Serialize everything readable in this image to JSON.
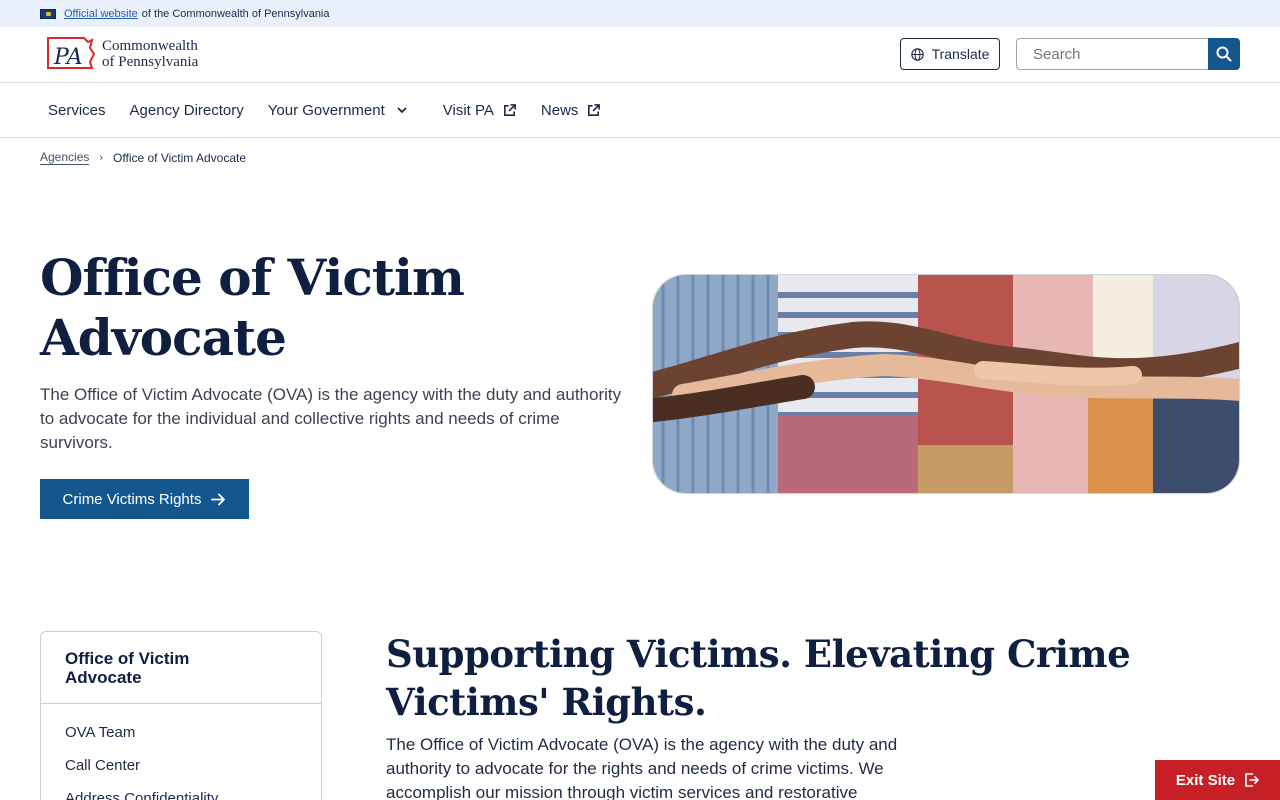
{
  "banner": {
    "link_text": "Official website",
    "rest_text": "of the Commonwealth of Pennsylvania"
  },
  "header": {
    "logo_mark": "PA",
    "logo_line1": "Commonwealth",
    "logo_line2": "of Pennsylvania",
    "translate_label": "Translate",
    "search_placeholder": "Search"
  },
  "nav": {
    "items": [
      {
        "label": "Services",
        "icon": "none"
      },
      {
        "label": "Agency Directory",
        "icon": "none"
      },
      {
        "label": "Your Government",
        "icon": "chevron-down-icon"
      },
      {
        "label": "Visit PA",
        "icon": "external-link-icon"
      },
      {
        "label": "News",
        "icon": "external-link-icon"
      }
    ]
  },
  "breadcrumb": {
    "items": [
      "Agencies",
      "Office of Victim Advocate"
    ]
  },
  "hero": {
    "title_line1": "Office of Victim",
    "title_line2": "Advocate",
    "description": "The Office of Victim Advocate (OVA) is the agency with the duty and authority to advocate for the individual and collective rights and needs of crime survivors.",
    "cta_label": "Crime Victims Rights"
  },
  "sidenav": {
    "title_line1": "Office of Victim",
    "title_line2": "Advocate",
    "items": [
      "OVA Team",
      "Call Center",
      "Address Confidentiality"
    ]
  },
  "section": {
    "title": "Supporting Victims. Elevating Crime Victims' Rights.",
    "body": "The Office of Victim Advocate (OVA) is the agency with the duty and authority to advocate for the rights and needs of crime victims. We accomplish our mission through victim services and restorative"
  },
  "exit": {
    "label": "Exit Site"
  },
  "colors": {
    "accent": "#14578f",
    "heading": "#0f1f40",
    "exit": "#c62026",
    "banner_bg": "#eaf0fb"
  }
}
